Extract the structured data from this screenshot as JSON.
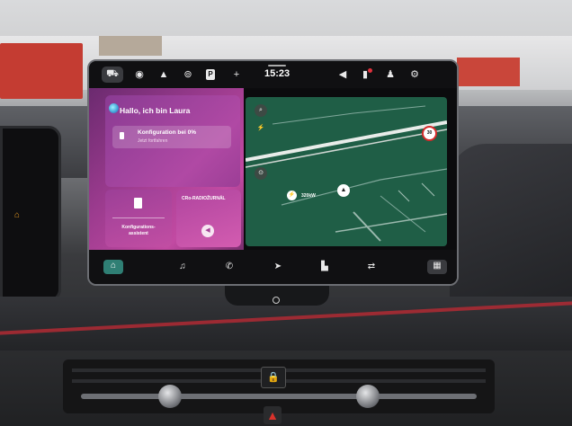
{
  "statusbar": {
    "time": "15:23",
    "icons": [
      "car-icon",
      "user-circle-icon",
      "triangle-icon",
      "seat-icon",
      "parking-icon",
      "plus-icon",
      "volume-icon",
      "phone-icon",
      "person-icon",
      "user-settings-icon"
    ]
  },
  "assistant": {
    "greeting": "Hallo, ich bin Laura",
    "config_title": "Konfiguration bei 0%",
    "config_sub": "Jetzt fortfahren"
  },
  "tiles": {
    "config_assistant_label": "Konfigurations-\nassistent",
    "radio_label": "CRo-RADIOŽURNÁL"
  },
  "map": {
    "speed_limit": "30",
    "charger_label": "320kW"
  },
  "dock": {
    "icons": [
      "home-icon",
      "music-icon",
      "phone-icon",
      "navigation-icon",
      "apps-icon",
      "connect-icon",
      "grid-icon"
    ]
  },
  "colors": {
    "tile_gradient": "#b049a4",
    "map_green": "#1f5e46",
    "dock_home_accent": "#2f7f74",
    "speed_ring": "#d42a2a"
  }
}
